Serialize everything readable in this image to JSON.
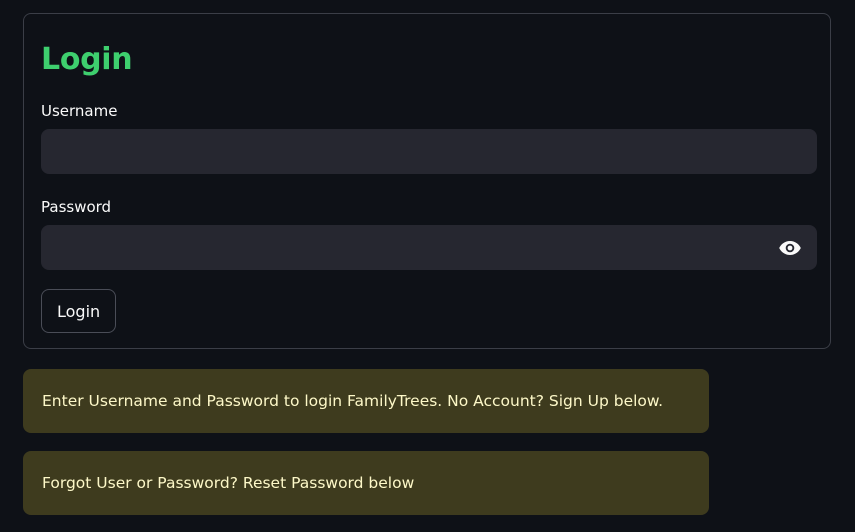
{
  "login_form": {
    "title": "Login",
    "username": {
      "label": "Username",
      "value": "",
      "placeholder": ""
    },
    "password": {
      "label": "Password",
      "value": "",
      "placeholder": "",
      "toggle_icon": "eye-icon"
    },
    "submit_label": "Login"
  },
  "messages": {
    "info": "Enter Username and Password to login FamilyTrees. No Account? Sign Up below.",
    "reset": "Forgot User or Password? Reset Password below"
  },
  "colors": {
    "background": "#0e1117",
    "title": "#3ecf6e",
    "input_background": "#262730",
    "alert_background": "#3e3b1e",
    "alert_text": "#fdf8c8"
  }
}
